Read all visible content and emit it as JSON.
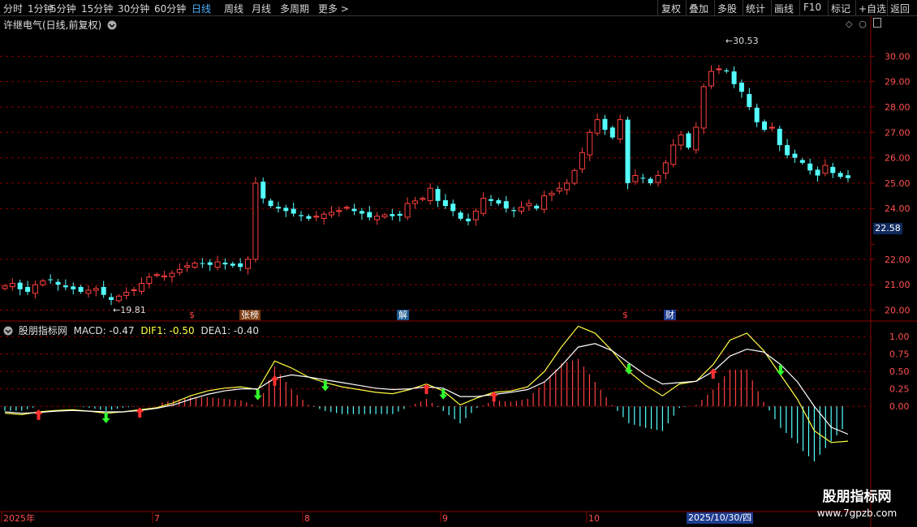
{
  "periods": [
    "分时",
    "1分钟",
    "5分钟",
    "15分钟",
    "30分钟",
    "60分钟",
    "日线",
    "周线",
    "月线",
    "多周期",
    "更多 >"
  ],
  "active_period": "日线",
  "toolbar": [
    "复权",
    "叠加",
    "多股",
    "统计",
    "画线",
    "F10",
    "标记",
    "+自选",
    "返回"
  ],
  "stock_title": "许继电气(日线,前复权)",
  "indicator": {
    "name": "股朋指标网",
    "macd": "MACD: -0.47",
    "dif": "DIF1: -0.50",
    "dea": "DEA1: -0.40"
  },
  "price_axis": [
    "30.00",
    "29.00",
    "28.00",
    "27.00",
    "26.00",
    "25.00",
    "24.00",
    "22.58",
    "22.00",
    "21.00",
    "20.00"
  ],
  "macd_axis": [
    "1.00",
    "0.75",
    "0.50",
    "0.25",
    "0.00"
  ],
  "date_axis": [
    "2025年",
    "7",
    "8",
    "9",
    "10"
  ],
  "current_price": "22.58",
  "high_label": "30.53",
  "low_label": "19.81",
  "badges": {
    "zhangbang": "张榜",
    "jie": "解",
    "cai": "财"
  },
  "hover_date": "2025/10/30/四",
  "watermark": {
    "line1": "股朋指标网",
    "line2": "www.7gpzb.com"
  },
  "colors": {
    "up": "#ff4040",
    "down": "#54ffff",
    "dif": "#ffffff",
    "dea": "#ffff40",
    "grid": "#8b0000"
  },
  "chart_data": {
    "type": "candlestick",
    "closes": [
      20.95,
      21.05,
      20.82,
      20.72,
      21.0,
      21.15,
      21.2,
      21.0,
      20.9,
      20.82,
      20.72,
      20.78,
      20.85,
      20.6,
      20.4,
      20.55,
      20.7,
      20.8,
      21.05,
      21.3,
      21.4,
      21.35,
      21.45,
      21.6,
      21.75,
      21.85,
      21.82,
      21.78,
      21.9,
      21.8,
      21.75,
      21.7,
      22.0,
      25.0,
      24.4,
      24.1,
      24.0,
      23.9,
      23.8,
      23.7,
      23.6,
      23.7,
      23.78,
      23.85,
      23.92,
      24.05,
      23.9,
      23.8,
      23.65,
      23.7,
      23.75,
      23.7,
      23.72,
      24.2,
      24.3,
      24.4,
      24.8,
      24.3,
      24.1,
      23.9,
      23.6,
      23.5,
      23.9,
      24.4,
      24.3,
      24.2,
      24.0,
      23.9,
      24.05,
      24.2,
      24.0,
      24.5,
      24.6,
      24.8,
      25.0,
      25.5,
      26.2,
      27.0,
      27.5,
      27.1,
      26.8,
      27.5,
      25.0,
      25.3,
      25.2,
      25.0,
      25.3,
      25.8,
      26.5,
      26.9,
      26.4,
      27.2,
      28.8,
      29.4,
      29.5,
      29.4,
      28.9,
      28.6,
      28.0,
      27.4,
      27.1,
      27.2,
      26.5,
      26.1,
      26.0,
      25.8,
      25.5,
      25.3,
      25.7,
      25.4,
      25.25,
      25.2
    ],
    "ylim": [
      19.6,
      31.0
    ],
    "macd": {
      "dif": [
        -0.1,
        -0.12,
        -0.08,
        -0.06,
        -0.05,
        -0.07,
        -0.1,
        -0.08,
        -0.05,
        -0.02,
        0.05,
        0.15,
        0.22,
        0.26,
        0.28,
        0.24,
        0.65,
        0.55,
        0.42,
        0.34,
        0.28,
        0.24,
        0.2,
        0.18,
        0.24,
        0.32,
        0.22,
        0.02,
        0.12,
        0.2,
        0.22,
        0.28,
        0.5,
        0.85,
        1.15,
        1.05,
        0.8,
        0.5,
        0.3,
        0.15,
        0.32,
        0.36,
        0.6,
        0.95,
        1.05,
        0.8,
        0.45,
        0.1,
        -0.35,
        -0.52,
        -0.5
      ],
      "dea": [
        -0.08,
        -0.1,
        -0.09,
        -0.07,
        -0.06,
        -0.07,
        -0.08,
        -0.08,
        -0.06,
        -0.03,
        0.02,
        0.1,
        0.17,
        0.22,
        0.25,
        0.25,
        0.4,
        0.45,
        0.42,
        0.38,
        0.34,
        0.3,
        0.26,
        0.24,
        0.25,
        0.28,
        0.26,
        0.14,
        0.14,
        0.17,
        0.2,
        0.24,
        0.35,
        0.58,
        0.85,
        0.9,
        0.8,
        0.62,
        0.45,
        0.32,
        0.34,
        0.36,
        0.5,
        0.72,
        0.82,
        0.78,
        0.6,
        0.35,
        0.0,
        -0.3,
        -0.4
      ],
      "ylim": [
        -1.5,
        1.2
      ]
    }
  }
}
